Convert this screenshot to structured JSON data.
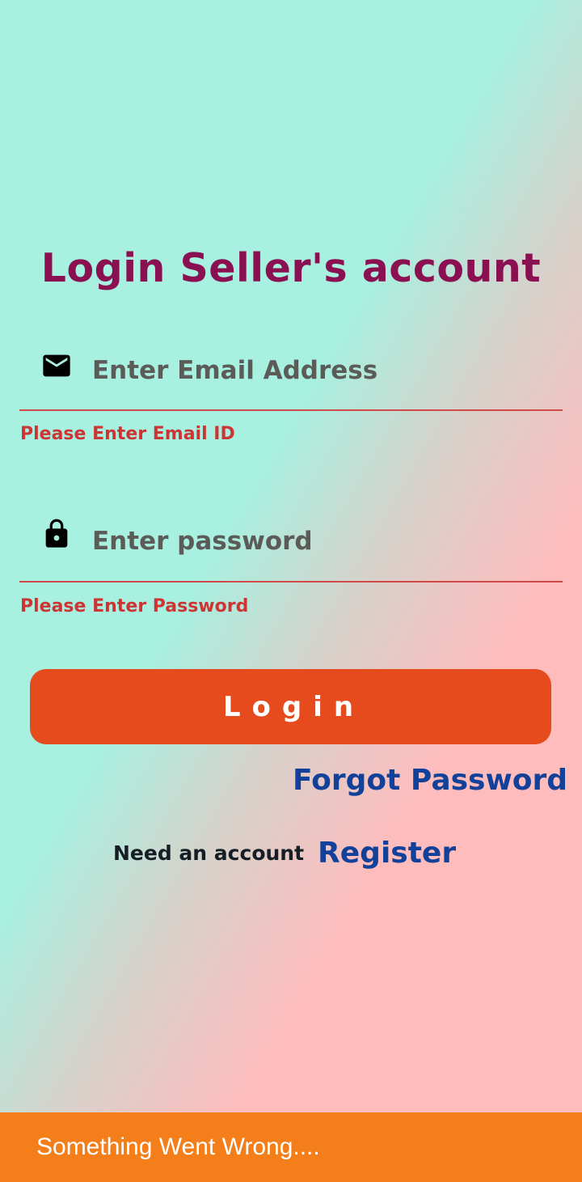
{
  "page": {
    "title": "Login Seller's account"
  },
  "email": {
    "placeholder": "Enter Email Address",
    "value": "",
    "icon": "mail-icon",
    "error": "Please Enter Email ID"
  },
  "password": {
    "placeholder": "Enter password",
    "value": "",
    "icon": "lock-icon",
    "error": "Please Enter Password"
  },
  "actions": {
    "login_label": "Login",
    "forgot_label": "Forgot Password",
    "need_account_label": "Need an account",
    "register_label": "Register"
  },
  "snackbar": {
    "message": "Something Went Wrong...."
  },
  "colors": {
    "title": "#8b1052",
    "error": "#cd3535",
    "login_button": "#e54b1c",
    "link": "#12419a",
    "snackbar": "#f47f1a",
    "gradient_teal": "#a8f0e0",
    "gradient_pink": "#ffbcbc"
  }
}
